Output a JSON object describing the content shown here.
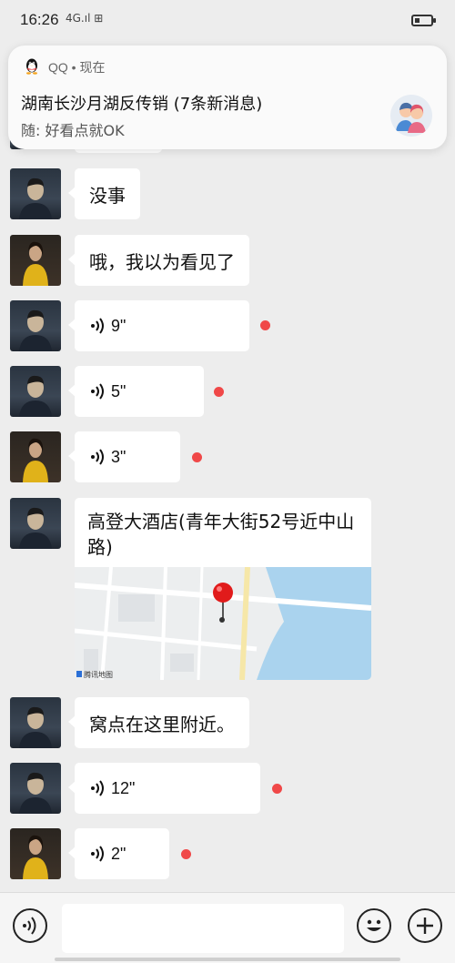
{
  "status": {
    "time": "16:26",
    "signal": "4G.ıl ⊞",
    "battery_level": 0.3
  },
  "notification": {
    "app": "QQ • 现在",
    "title": "湖南长沙月湖反传销 (7条新消息)",
    "body": "随: 好看点就OK"
  },
  "messages": [
    {
      "type": "text",
      "text": "没事"
    },
    {
      "type": "text",
      "text": "哦，我以为看见了"
    },
    {
      "type": "voice",
      "duration": "9\""
    },
    {
      "type": "voice",
      "duration": "5\""
    },
    {
      "type": "voice",
      "duration": "3\""
    },
    {
      "type": "location",
      "title": "高登大酒店(青年大街52号近中山路)",
      "map_provider": "腾讯地图"
    },
    {
      "type": "text",
      "text": "窝点在这里附近。"
    },
    {
      "type": "voice",
      "duration": "12\""
    },
    {
      "type": "voice",
      "duration": "2\""
    }
  ],
  "colors": {
    "background": "#ededed",
    "bubble": "#ffffff",
    "unread_dot": "#f04848",
    "map_pin": "#e11b1b"
  }
}
